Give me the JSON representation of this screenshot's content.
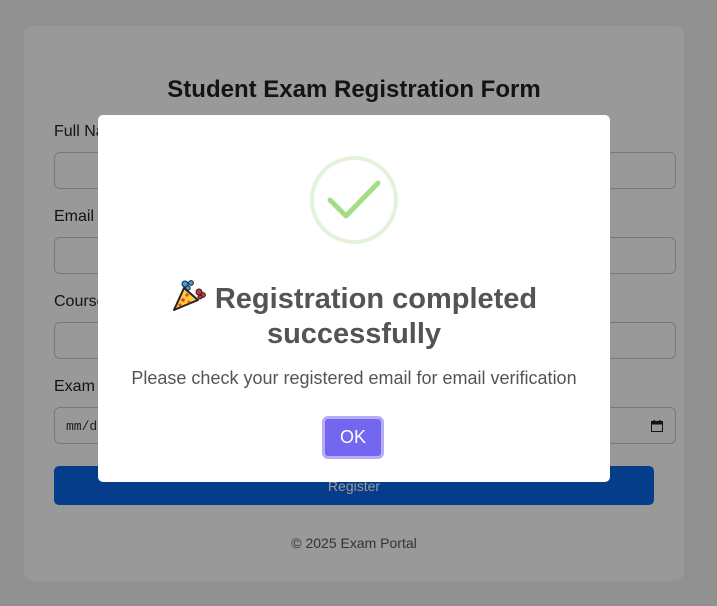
{
  "form": {
    "title": "Student Exam Registration Form",
    "fields": [
      {
        "label": "Full Name",
        "value": ""
      },
      {
        "label": "Email ID",
        "value": ""
      },
      {
        "label": "Course",
        "value": ""
      },
      {
        "label": "Exam Date",
        "placeholder": "mm/dd/yyyy"
      }
    ],
    "register_label": "Register",
    "footer": "© 2025 Exam Portal"
  },
  "modal": {
    "icon": "success-check-icon",
    "title_icon": "party-popper-icon",
    "title": "Registration completed successfully",
    "message": "Please check your registered email for email verification",
    "ok_label": "OK"
  },
  "colors": {
    "primary_button": "#0a66e6",
    "confirm_button": "#7367f0",
    "success_green": "#a5dc86"
  }
}
